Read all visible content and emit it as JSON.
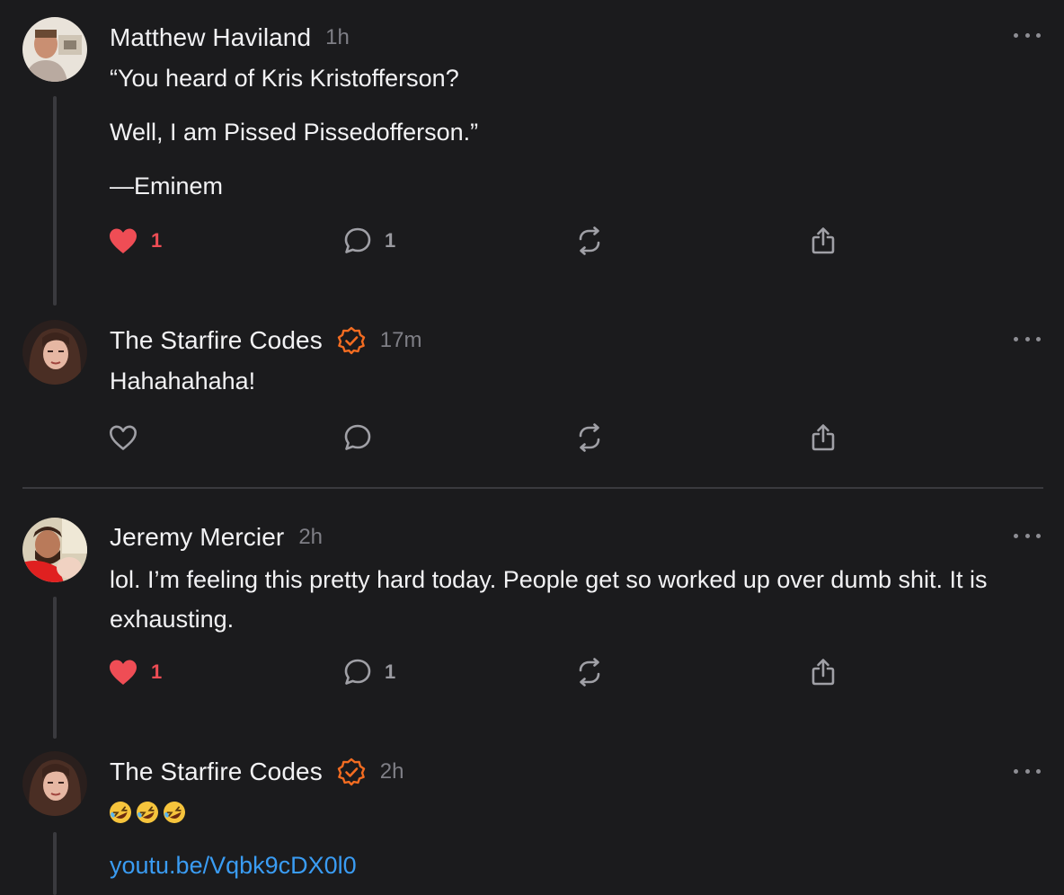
{
  "posts": [
    {
      "author": "Matthew Haviland",
      "time": "1h",
      "verified": false,
      "paragraphs": [
        "“You heard of Kris Kristofferson?",
        "Well, I am Pissed Pissedofferson.”",
        "—Eminem"
      ],
      "likes": "1",
      "liked": true,
      "replies": "1"
    },
    {
      "author": "The Starfire Codes",
      "time": "17m",
      "verified": true,
      "paragraphs": [
        "Hahahahaha!"
      ],
      "likes": "",
      "liked": false,
      "replies": ""
    },
    {
      "author": "Jeremy Mercier",
      "time": "2h",
      "verified": false,
      "paragraphs": [
        "lol. I’m feeling this pretty hard today. People get so worked up over dumb shit. It is exhausting."
      ],
      "likes": "1",
      "liked": true,
      "replies": "1"
    },
    {
      "author": "The Starfire Codes",
      "time": "2h",
      "verified": true,
      "emoji": "🤣🤣🤣",
      "link": "youtu.be/Vqbk9cDX0l0"
    }
  ],
  "icons": {
    "like": "heart-icon",
    "reply": "comment-bubble-icon",
    "repost": "repost-icon",
    "share": "share-icon",
    "more": "more-options-icon",
    "verified": "verified-badge-icon"
  },
  "colors": {
    "background": "#1b1b1d",
    "liked": "#ef4d55",
    "verified": "#f36c21",
    "link": "#3a9cf3",
    "muted": "#7f7f86"
  }
}
